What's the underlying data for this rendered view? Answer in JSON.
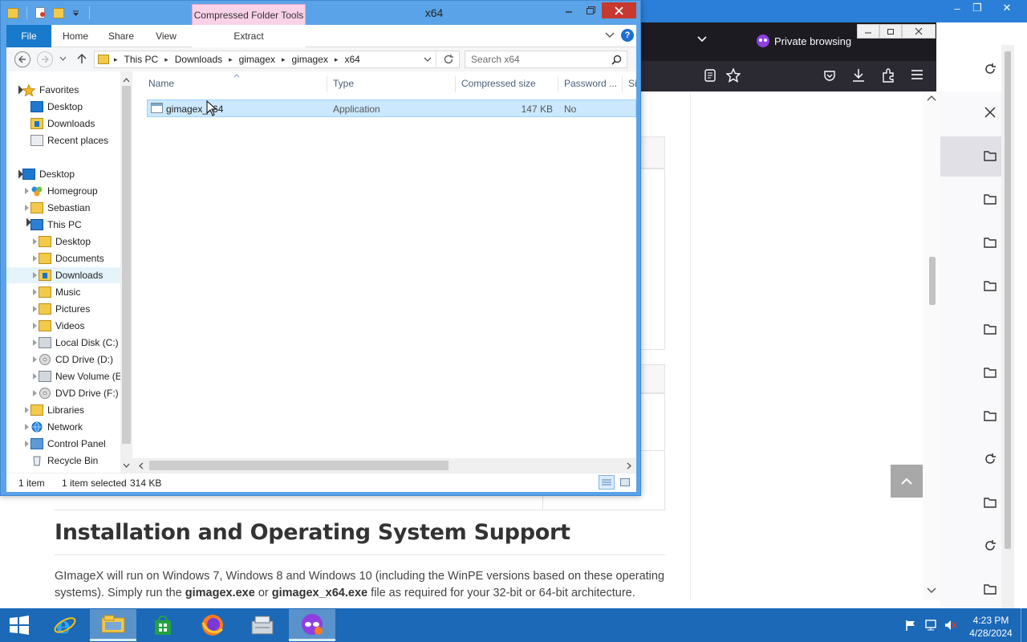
{
  "explorer": {
    "title": "x64",
    "context_tab": "Compressed Folder Tools",
    "ribbon_tabs": [
      "File",
      "Home",
      "Share",
      "View",
      "Extract"
    ],
    "breadcrumb": [
      "This PC",
      "Downloads",
      "gimagex",
      "gimagex",
      "x64"
    ],
    "search_placeholder": "Search x64",
    "nav": {
      "favorites": "Favorites",
      "fav_items": [
        "Desktop",
        "Downloads",
        "Recent places"
      ],
      "desktop": "Desktop",
      "desktop_items": [
        "Homegroup",
        "Sebastian",
        "This PC"
      ],
      "thispc_items": [
        "Desktop",
        "Documents",
        "Downloads",
        "Music",
        "Pictures",
        "Videos",
        "Local Disk (C:)",
        "CD Drive (D:)",
        "New Volume (E",
        "DVD Drive (F:) v"
      ],
      "other_items": [
        "Libraries",
        "Network",
        "Control Panel",
        "Recycle Bin"
      ]
    },
    "columns": [
      "Name",
      "Type",
      "Compressed size",
      "Password ...",
      "Si"
    ],
    "files": [
      {
        "name": "gimagex_x64",
        "type": "Application",
        "compressed_size": "147 KB",
        "password": "No"
      }
    ],
    "status": {
      "count": "1 item",
      "selected": "1 item selected",
      "size": "314 KB"
    }
  },
  "browser": {
    "private_label": "Private browsing",
    "heading": "Installation and Operating System Support",
    "para_1": "GImageX will run on Windows 7, Windows 8 and Windows 10 (including the WinPE versions based on these operating systems). Simply run the ",
    "para_exe1": "gimagex.exe",
    "para_or": " or ",
    "para_exe2": "gimagex_x64.exe",
    "para_2": " file as required for your 32-bit or 64-bit architecture."
  },
  "taskbar": {
    "time": "4:23 PM",
    "date": "4/28/2024"
  },
  "colors": {
    "selection": "#cce8ff",
    "accent": "#1979ca",
    "taskbar": "#1b69b7",
    "context_tab": "#f9d2e8"
  }
}
